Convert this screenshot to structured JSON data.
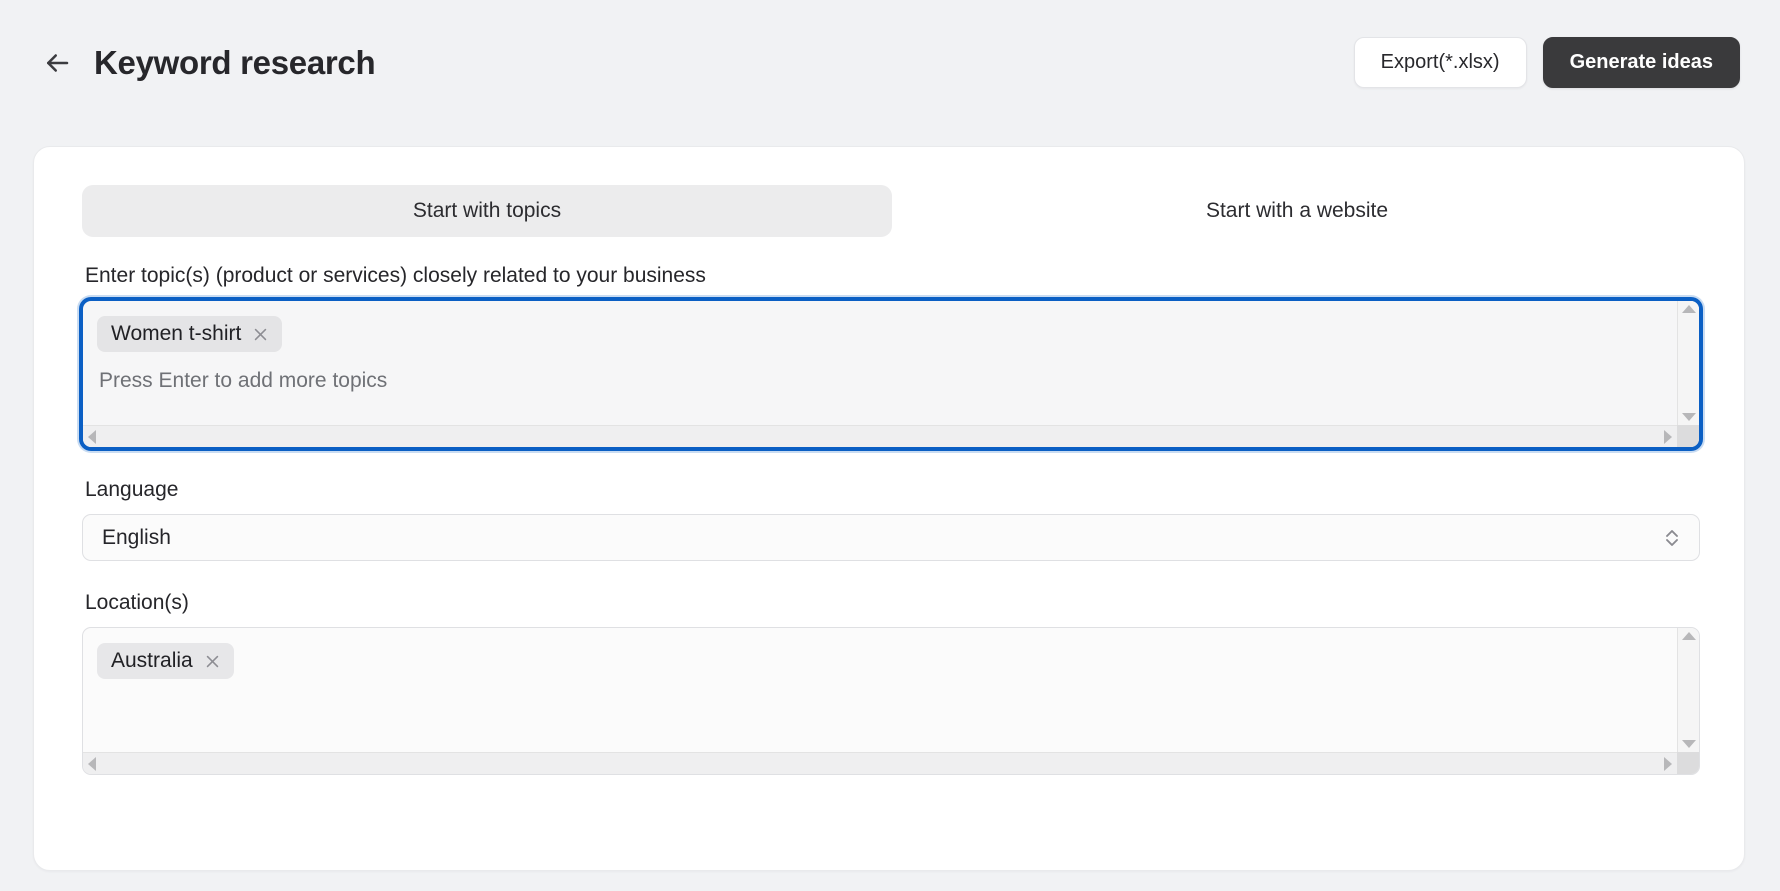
{
  "header": {
    "back_icon": "arrow-left-icon",
    "title": "Keyword research",
    "export_label": "Export(*.xlsx)",
    "generate_label": "Generate ideas"
  },
  "tabs": [
    {
      "label": "Start with topics",
      "active": true
    },
    {
      "label": "Start with a website",
      "active": false
    }
  ],
  "topics": {
    "label": "Enter topic(s) (product or services) closely related to your business",
    "chips": [
      {
        "label": "Women t-shirt",
        "remove_icon": "close-icon"
      }
    ],
    "placeholder": "Press Enter to add more topics",
    "focused": true
  },
  "language": {
    "label": "Language",
    "value": "English",
    "caret_icon": "chevron-up-down-icon"
  },
  "locations": {
    "label": "Location(s)",
    "chips": [
      {
        "label": "Australia",
        "remove_icon": "close-icon"
      }
    ]
  },
  "colors": {
    "page_background": "#f1f2f4",
    "card_background": "#ffffff",
    "primary_button": "#3a3a3c",
    "focus_ring": "#0b5fc4",
    "chip_background": "#e7e7e9",
    "tab_active_background": "#ececed"
  }
}
